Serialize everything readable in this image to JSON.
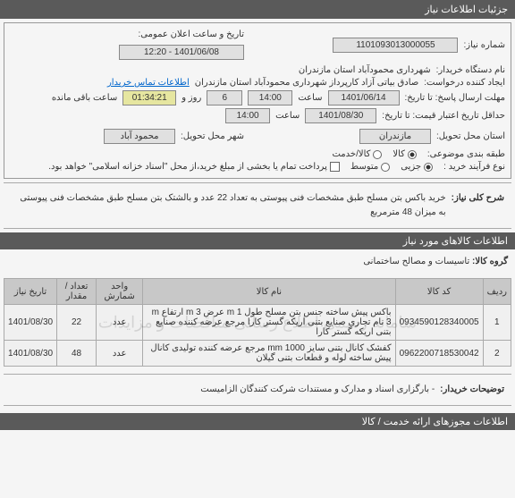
{
  "header": {
    "title": "جزئیات اطلاعات نیاز"
  },
  "fields": {
    "req_no_label": "شماره نیاز:",
    "req_no": "1101093013000055",
    "public_date_label": "تاریخ و ساعت اعلان عمومی:",
    "public_date": "1401/06/08 - 12:20",
    "buyer_org_label": "نام دستگاه خریدار:",
    "buyer_org": "شهرداری محمودآباد استان مازندران",
    "creator_label": "ایجاد کننده درخواست:",
    "creator": "صادق بیاتی آزاد کارپرداز شهرداری محمودآباد استان مازندران",
    "contact_link": "اطلاعات تماس خریدار",
    "deadline_label": "مهلت ارسال پاسخ: تا تاریخ:",
    "deadline_date": "1401/06/14",
    "saat": "ساعت",
    "deadline_time": "14:00",
    "rooz_va": "روز و",
    "days_left": "6",
    "remain_label": "ساعت باقی مانده",
    "remain_time": "01:34:21",
    "min_valid_label": "حداقل تاریخ اعتبار قیمت: تا تاریخ:",
    "min_valid_date": "1401/08/30",
    "min_valid_time": "14:00",
    "province_label": "استان محل تحویل:",
    "province": "مازندران",
    "city_label": "شهر محل تحویل:",
    "city": "محمود آباد",
    "topic_label": "طبقه بندی موضوعی:",
    "topic_goods": "کالا",
    "topic_service": "کالا/خدمت",
    "process_label": "نوع فرآیند خرید :",
    "proc_low": "جزیی",
    "proc_mid": "متوسط",
    "note": "پرداخت تمام یا بخشی از مبلغ خرید،از محل \"اسناد خزانه اسلامی\" خواهد بود."
  },
  "summary": {
    "label": "شرح کلی نیاز:",
    "text": "خرید باکس بتن مسلح طبق مشخصات فنی پیوستی به تعداد 22 عدد و بالشتک بتن مسلح طبق مشخصات فنی پیوستی به میزان 48 مترمربع"
  },
  "goods_header": "اطلاعات کالاهای مورد نیاز",
  "group": {
    "label": "گروه کالا:",
    "value": "تاسیسات و مصالح ساختمانی"
  },
  "watermark": "سامانه رسمی اطلاع رسانی مناقصات و مزایدات",
  "table": {
    "headers": {
      "row": "ردیف",
      "code": "کد کالا",
      "name": "نام کالا",
      "unit": "واحد شمارش",
      "qty": "تعداد / مقدار",
      "date": "تاریخ نیاز"
    },
    "rows": [
      {
        "idx": "1",
        "code": "0934590128340005",
        "name": "باکس پیش ساخته جنس بتن مسلح طول m 1 عرض m 3 ارتفاع m 3 نام تجاری صنایع بتنی اریکه گستر کارا مرجع عرضه کننده صنایع بتنی اریکه گستر کارا",
        "unit": "عدد",
        "qty": "22",
        "date": "1401/08/30"
      },
      {
        "idx": "2",
        "code": "0962200718530042",
        "name": "کفشک کانال بتنی سایز mm 1000 مرجع عرضه کننده تولیدی کانال پیش ساخته لوله و قطعات بتنی گیلان",
        "unit": "عدد",
        "qty": "48",
        "date": "1401/08/30"
      }
    ]
  },
  "buyer_notes": {
    "label": "توضیحات خریدار:",
    "text": "- بارگزاری اسناد و مدارک و مستندات شرکت کنندگان الزامیست"
  },
  "footer_row": "اطلاعات مجوزهای ارائه خدمت / کالا"
}
